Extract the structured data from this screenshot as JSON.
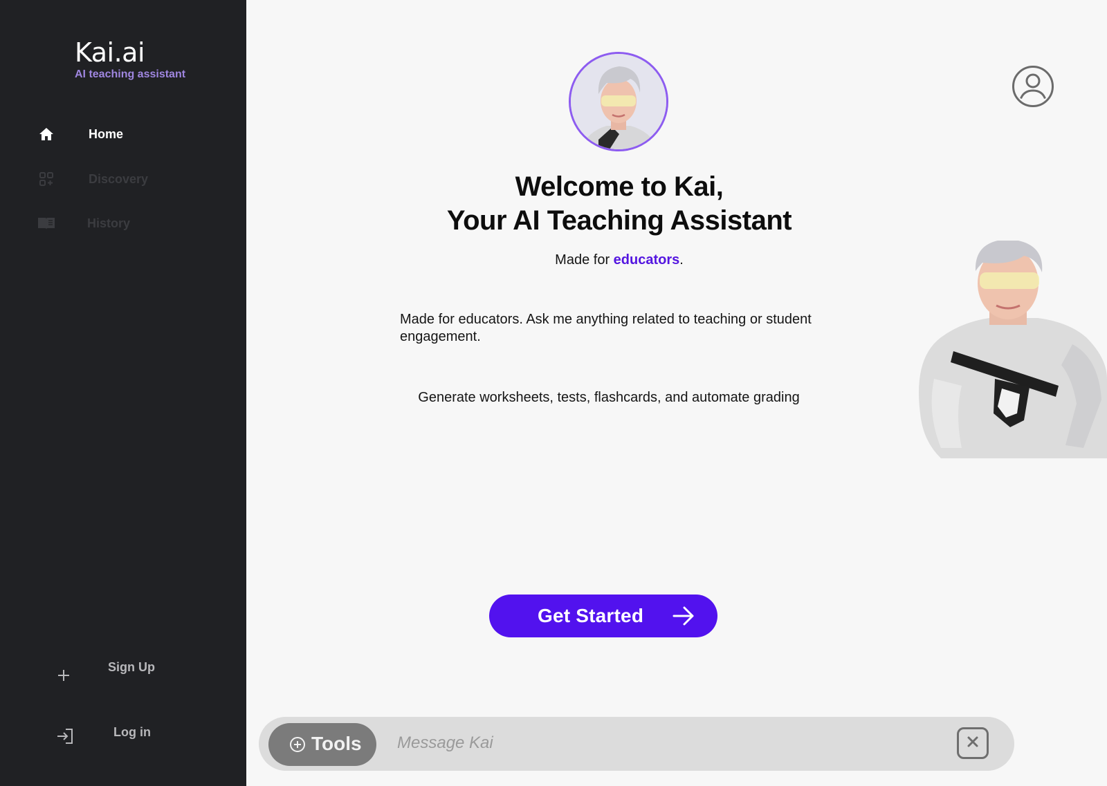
{
  "brand": {
    "title": "Kai.ai",
    "subtitle": "AI teaching assistant"
  },
  "sidebar": {
    "items": [
      {
        "label": "Home",
        "icon": "home-icon",
        "active": true
      },
      {
        "label": "Discovery",
        "icon": "discovery-icon",
        "active": false
      },
      {
        "label": "History",
        "icon": "book-icon",
        "active": false
      }
    ],
    "auth": {
      "signup_label": "Sign Up",
      "signup_icon": "plus-icon",
      "login_label": "Log in",
      "login_icon": "login-icon"
    }
  },
  "hero": {
    "title_line1": "Welcome to Kai,",
    "title_line2": "Your AI Teaching Assistant",
    "made_for_prefix": "Made for ",
    "made_for_accent": "educators",
    "made_for_suffix": ".",
    "description": "Made for educators. Ask me anything related to teaching or student engagement.",
    "features": "Generate worksheets, tests, flashcards, and automate grading"
  },
  "cta": {
    "label": "Get Started",
    "icon": "arrow-right-icon"
  },
  "composer": {
    "tools_label": "Tools",
    "tools_icon": "plus-circle-icon",
    "placeholder": "Message Kai",
    "clear_icon": "close-icon"
  },
  "header": {
    "profile_icon": "user-profile-icon"
  },
  "colors": {
    "sidebar_bg": "#202124",
    "accent": "#5212ee",
    "brand_sub": "#9f86e0",
    "main_bg": "#f7f7f7"
  }
}
